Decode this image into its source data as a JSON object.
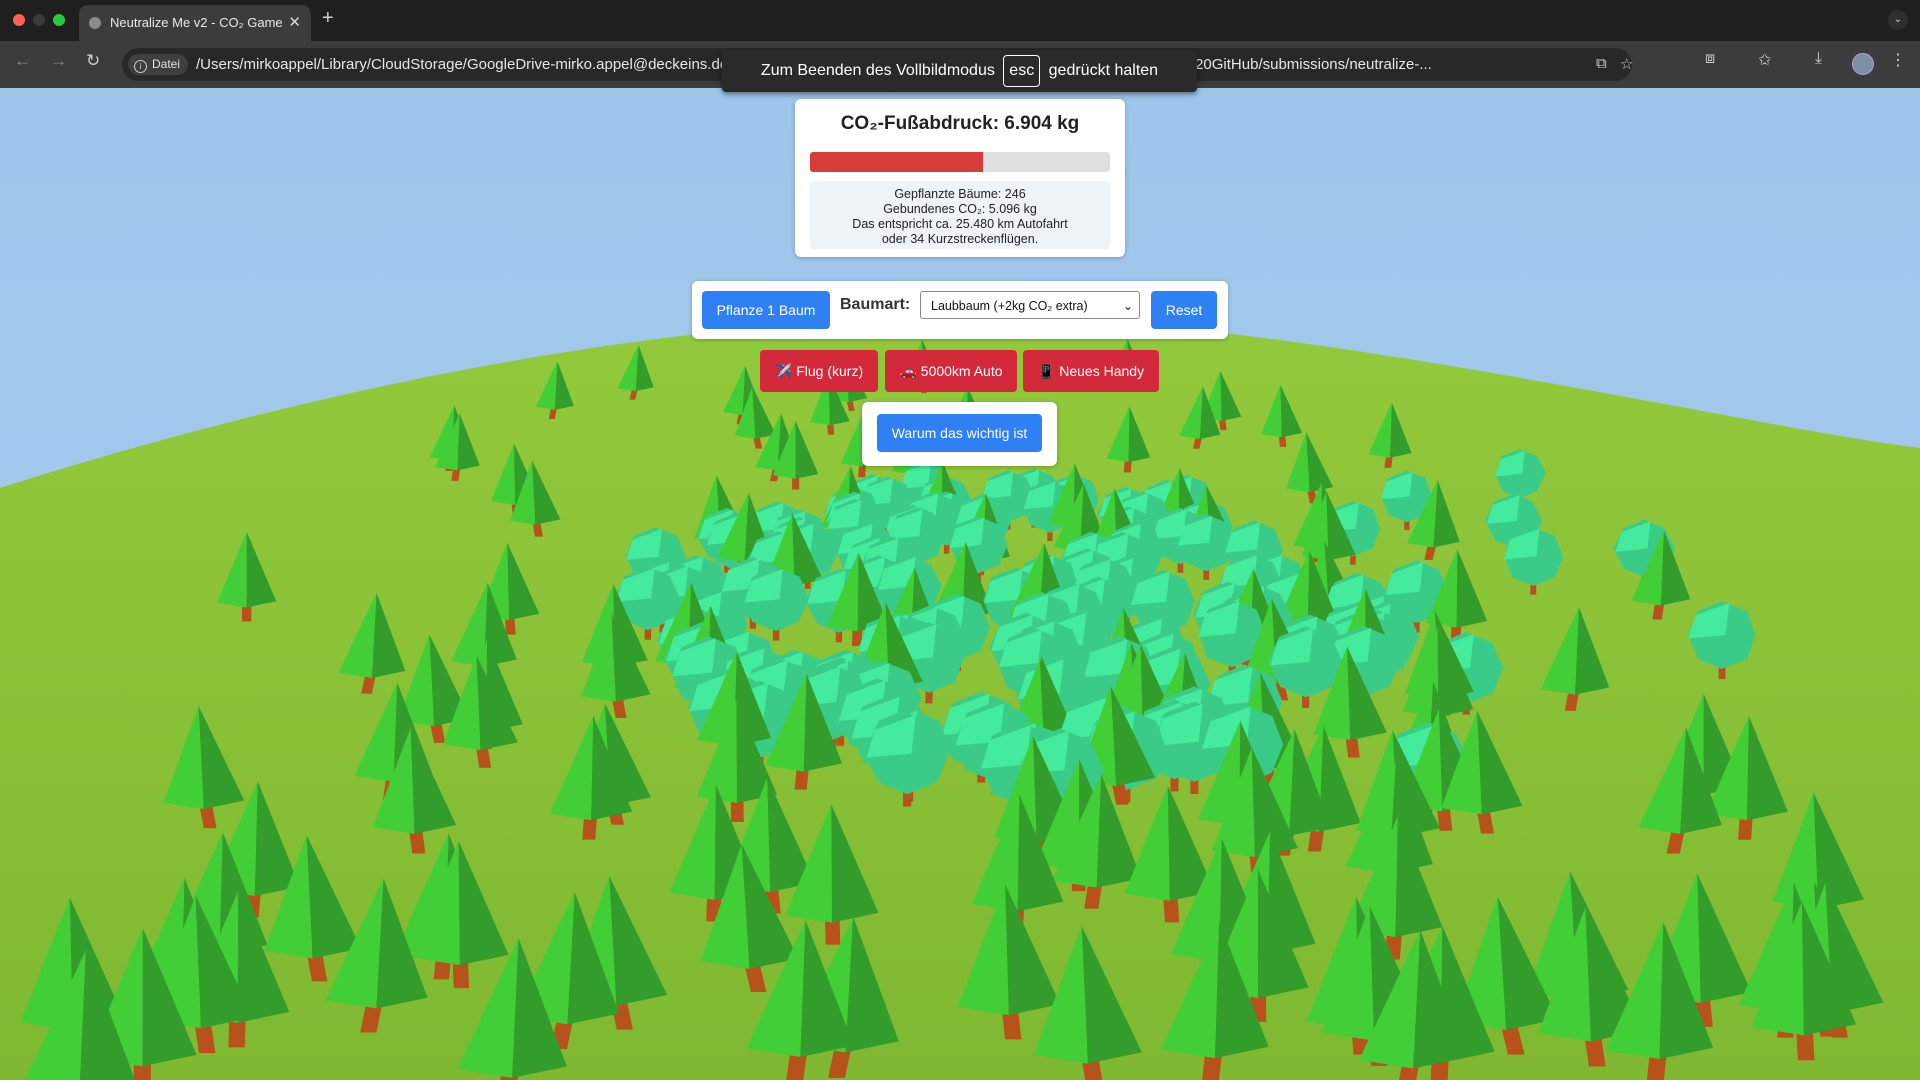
{
  "browser": {
    "tab_title": "Neutralize Me v2 - CO₂ Game",
    "url_chip": "Datei",
    "url": "/Users/mirkoappel/Library/CloudStorage/GoogleDrive-mirko.appel@deckeins.de/Geteilte Ablagen/Prozesse 2024/20 Coding%20(CO2%20Game)/10%20GitHub/submissions/neutralize-...",
    "fullscreen_prefix": "Zum Beenden des Vollbildmodus",
    "fullscreen_key": "esc",
    "fullscreen_suffix": "gedrückt halten"
  },
  "footprint": {
    "title": "CO₂-Fußabdruck: 6.904 kg",
    "progress": 0.575,
    "bar_color": "#d63c3c",
    "stats": {
      "trees": "Gepflanzte Bäume: 246",
      "bound": "Gebundenes CO₂: 5.096 kg",
      "equiv_car": "Das entspricht ca. 25.480 km Autofahrt",
      "equiv_flights": "oder 34 Kurzstreckenflügen."
    }
  },
  "controls": {
    "plant_button": "Pflanze 1 Baum",
    "tree_type_label": "Baumart:",
    "tree_type_selected": "Laubbaum (+2kg CO₂ extra)",
    "reset_button": "Reset"
  },
  "emissions": {
    "flight_button": "✈️ Flug (kurz)",
    "car_button": "🚗 5000km Auto",
    "phone_button": "📱 Neues Handy"
  },
  "info": {
    "why_button": "Warum das wichtig ist"
  },
  "colors": {
    "sky": "#9fc8ea",
    "grass": "#8cc43a",
    "conifer": "#3dbf33",
    "deciduous": "#3ed68f",
    "trunk": "#b7521b",
    "button_blue": "#2f80f3",
    "button_red": "#d22a3a"
  }
}
